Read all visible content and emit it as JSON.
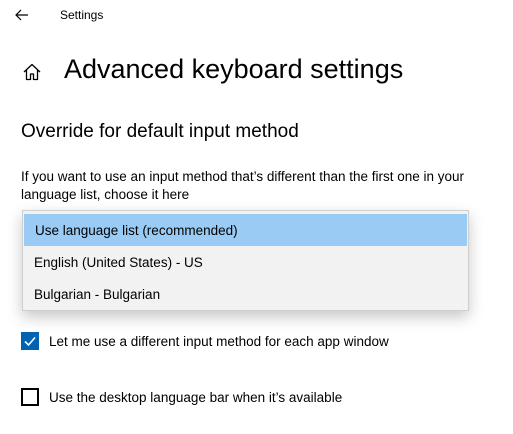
{
  "titlebar": {
    "back_icon": "back-arrow-icon",
    "app_title": "Settings"
  },
  "header": {
    "home_icon": "home-icon",
    "page_title": "Advanced keyboard settings"
  },
  "override_section": {
    "title": "Override for default input method",
    "description": "If you want to use an input method that’s different than the first one in your language list, choose it here",
    "dropdown": {
      "options": [
        {
          "label": "Use language list (recommended)",
          "selected": true
        },
        {
          "label": "English (United States) - US",
          "selected": false
        },
        {
          "label": "Bulgarian - Bulgarian",
          "selected": false
        }
      ]
    }
  },
  "options": {
    "per_app_input": {
      "label": "Let me use a different input method for each app window",
      "checked": true
    },
    "desktop_language_bar": {
      "label": "Use the desktop language bar when it’s available",
      "checked": false
    }
  },
  "colors": {
    "accent": "#0063b1",
    "selection_highlight": "#99cbf5",
    "dropdown_bg": "#f2f2f2"
  }
}
